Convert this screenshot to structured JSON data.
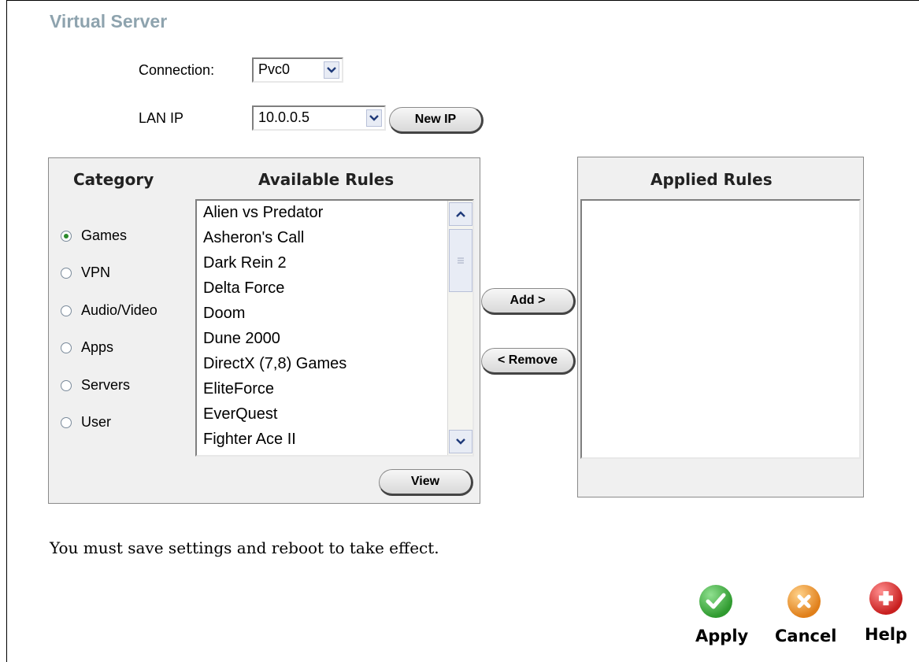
{
  "page": {
    "title": "Virtual Server"
  },
  "connection": {
    "label": "Connection:",
    "value": "Pvc0"
  },
  "lan_ip": {
    "label": "LAN IP",
    "value": "10.0.0.5",
    "new_ip_button": "New IP"
  },
  "category": {
    "heading": "Category",
    "options": [
      {
        "label": "Games",
        "checked": true
      },
      {
        "label": "VPN",
        "checked": false
      },
      {
        "label": "Audio/Video",
        "checked": false
      },
      {
        "label": "Apps",
        "checked": false
      },
      {
        "label": "Servers",
        "checked": false
      },
      {
        "label": "User",
        "checked": false
      }
    ]
  },
  "available_rules": {
    "heading": "Available Rules",
    "items": [
      "Alien vs Predator",
      "Asheron's Call",
      "Dark Rein 2",
      "Delta Force",
      "Doom",
      "Dune 2000",
      "DirectX (7,8) Games",
      "EliteForce",
      "EverQuest",
      "Fighter Ace II"
    ],
    "view_button": "View"
  },
  "buttons": {
    "add": "Add >",
    "remove": "< Remove"
  },
  "applied_rules": {
    "heading": "Applied Rules",
    "items": []
  },
  "notice": "You must save settings and reboot to take effect.",
  "actions": {
    "apply": {
      "label": "Apply",
      "icon": "check-icon",
      "color": "#3aa63a"
    },
    "cancel": {
      "label": "Cancel",
      "icon": "x-icon",
      "color": "#e8912a"
    },
    "help": {
      "label": "Help",
      "icon": "plus-icon",
      "color": "#d42a2a"
    }
  }
}
